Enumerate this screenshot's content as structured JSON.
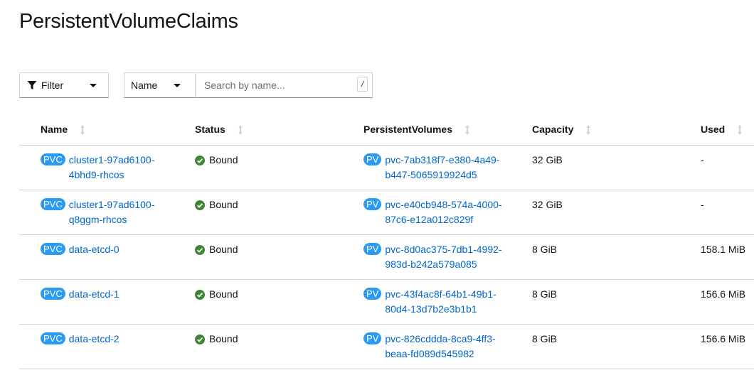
{
  "page": {
    "title": "PersistentVolumeClaims"
  },
  "toolbar": {
    "filter_label": "Filter",
    "filter_icon": "filter-icon",
    "attribute_label": "Name",
    "search_placeholder": "Search by name...",
    "search_value": "",
    "shortcut_hint": "/"
  },
  "table": {
    "columns": [
      {
        "label": "Name"
      },
      {
        "label": "Status"
      },
      {
        "label": "PersistentVolumes"
      },
      {
        "label": "Capacity"
      },
      {
        "label": "Used"
      }
    ],
    "rows": [
      {
        "pvc_badge": "PVC",
        "name_line1": "cluster1-97ad6100-",
        "name_line2": "4bhd9-rhcos",
        "status": "Bound",
        "pv_badge": "PV",
        "pv_line1": "pvc-7ab318f7-e380-4a49-",
        "pv_line2": "b447-5065919924d5",
        "capacity": "32 GiB",
        "used": "-"
      },
      {
        "pvc_badge": "PVC",
        "name_line1": "cluster1-97ad6100-",
        "name_line2": "q8ggm-rhcos",
        "status": "Bound",
        "pv_badge": "PV",
        "pv_line1": "pvc-e40cb948-574a-4000-",
        "pv_line2": "87c6-e12a012c829f",
        "capacity": "32 GiB",
        "used": "-"
      },
      {
        "pvc_badge": "PVC",
        "name_line1": "data-etcd-0",
        "name_line2": "",
        "status": "Bound",
        "pv_badge": "PV",
        "pv_line1": "pvc-8d0ac375-7db1-4992-",
        "pv_line2": "983d-b242a579a085",
        "capacity": "8 GiB",
        "used": "158.1 MiB"
      },
      {
        "pvc_badge": "PVC",
        "name_line1": "data-etcd-1",
        "name_line2": "",
        "status": "Bound",
        "pv_badge": "PV",
        "pv_line1": "pvc-43f4ac8f-64b1-49b1-",
        "pv_line2": "80d4-13d7b2e3b1b1",
        "capacity": "8 GiB",
        "used": "156.6 MiB"
      },
      {
        "pvc_badge": "PVC",
        "name_line1": "data-etcd-2",
        "name_line2": "",
        "status": "Bound",
        "pv_badge": "PV",
        "pv_line1": "pvc-826cddda-8ca9-4ff3-",
        "pv_line2": "beaa-fd089d545982",
        "capacity": "8 GiB",
        "used": "156.6 MiB"
      }
    ]
  },
  "colors": {
    "link": "#0066cc",
    "badge": "#2b9af3",
    "status_ok": "#3e8635",
    "border": "#d2d2d2"
  }
}
